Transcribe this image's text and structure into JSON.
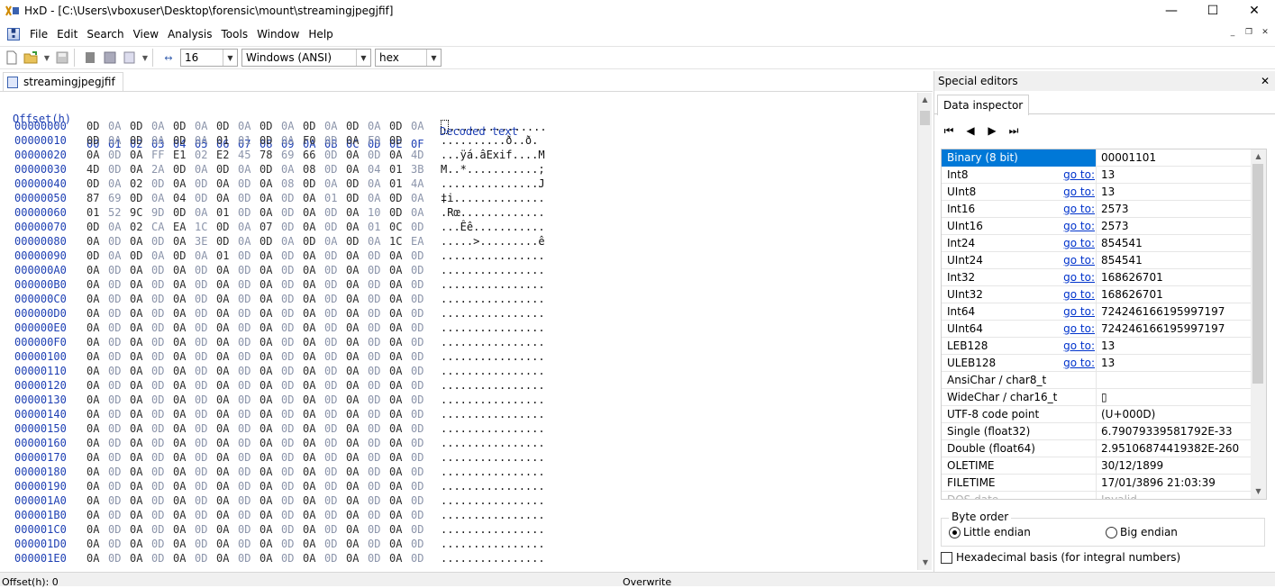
{
  "window": {
    "title": "HxD - [C:\\Users\\vboxuser\\Desktop\\forensic\\mount\\streamingjpegjfif]",
    "minimize": "—",
    "maximize": "☐",
    "close": "✕"
  },
  "menu": {
    "items": [
      "File",
      "Edit",
      "Search",
      "View",
      "Analysis",
      "Tools",
      "Window",
      "Help"
    ],
    "mdi_minimize": "_",
    "mdi_restore": "❐",
    "mdi_close": "✕"
  },
  "toolbar": {
    "bytes_per_row": "16",
    "charset": "Windows (ANSI)",
    "offset_base": "hex"
  },
  "document_tab": {
    "label": "streamingjpegjfif"
  },
  "hex_view": {
    "offset_header": "Offset(h)",
    "column_headers": [
      "00",
      "01",
      "02",
      "03",
      "04",
      "05",
      "06",
      "07",
      "08",
      "09",
      "0A",
      "0B",
      "0C",
      "0D",
      "0E",
      "0F"
    ],
    "decoded_header": "Decoded text",
    "rows": [
      {
        "offset": "00000000",
        "bytes": [
          "0D",
          "0A",
          "0D",
          "0A",
          "0D",
          "0A",
          "0D",
          "0A",
          "0D",
          "0A",
          "0D",
          "0A",
          "0D",
          "0A",
          "0D",
          "0A"
        ],
        "decoded_first": ".",
        "decoded": "..............."
      },
      {
        "offset": "00000010",
        "bytes": [
          "0D",
          "0A",
          "0D",
          "0A",
          "0D",
          "0A",
          "01",
          "01",
          "0D",
          "0A",
          "F0",
          "0D",
          "0A",
          "F0",
          "0D",
          ""
        ],
        "decoded": "..........ð..ð."
      },
      {
        "offset": "00000020",
        "bytes": [
          "0A",
          "0D",
          "0A",
          "FF",
          "E1",
          "02",
          "E2",
          "45",
          "78",
          "69",
          "66",
          "0D",
          "0A",
          "0D",
          "0A",
          "4D"
        ],
        "decoded": "...ÿá.âExif....M"
      },
      {
        "offset": "00000030",
        "bytes": [
          "4D",
          "0D",
          "0A",
          "2A",
          "0D",
          "0A",
          "0D",
          "0A",
          "0D",
          "0A",
          "08",
          "0D",
          "0A",
          "04",
          "01",
          "3B"
        ],
        "decoded": "M..*...........;"
      },
      {
        "offset": "00000040",
        "bytes": [
          "0D",
          "0A",
          "02",
          "0D",
          "0A",
          "0D",
          "0A",
          "0D",
          "0A",
          "08",
          "0D",
          "0A",
          "0D",
          "0A",
          "01",
          "4A"
        ],
        "decoded": "...............J"
      },
      {
        "offset": "00000050",
        "bytes": [
          "87",
          "69",
          "0D",
          "0A",
          "04",
          "0D",
          "0A",
          "0D",
          "0A",
          "0D",
          "0A",
          "01",
          "0D",
          "0A",
          "0D",
          "0A"
        ],
        "decoded": "‡i.............."
      },
      {
        "offset": "00000060",
        "bytes": [
          "01",
          "52",
          "9C",
          "9D",
          "0D",
          "0A",
          "01",
          "0D",
          "0A",
          "0D",
          "0A",
          "0D",
          "0A",
          "10",
          "0D",
          "0A"
        ],
        "decoded": ".Rœ............."
      },
      {
        "offset": "00000070",
        "bytes": [
          "0D",
          "0A",
          "02",
          "CA",
          "EA",
          "1C",
          "0D",
          "0A",
          "07",
          "0D",
          "0A",
          "0D",
          "0A",
          "01",
          "0C",
          "0D"
        ],
        "decoded": "...Êê..........."
      },
      {
        "offset": "00000080",
        "bytes": [
          "0A",
          "0D",
          "0A",
          "0D",
          "0A",
          "3E",
          "0D",
          "0A",
          "0D",
          "0A",
          "0D",
          "0A",
          "0D",
          "0A",
          "1C",
          "EA"
        ],
        "decoded": ".....>.........ê"
      },
      {
        "offset": "00000090",
        "bytes": [
          "0D",
          "0A",
          "0D",
          "0A",
          "0D",
          "0A",
          "01",
          "0D",
          "0A",
          "0D",
          "0A",
          "0D",
          "0A",
          "0D",
          "0A",
          "0D"
        ],
        "decoded": "................"
      },
      {
        "offset": "000000A0",
        "bytes": [
          "0A",
          "0D",
          "0A",
          "0D",
          "0A",
          "0D",
          "0A",
          "0D",
          "0A",
          "0D",
          "0A",
          "0D",
          "0A",
          "0D",
          "0A",
          "0D"
        ],
        "decoded": "................"
      },
      {
        "offset": "000000B0",
        "bytes": [
          "0A",
          "0D",
          "0A",
          "0D",
          "0A",
          "0D",
          "0A",
          "0D",
          "0A",
          "0D",
          "0A",
          "0D",
          "0A",
          "0D",
          "0A",
          "0D"
        ],
        "decoded": "................"
      },
      {
        "offset": "000000C0",
        "bytes": [
          "0A",
          "0D",
          "0A",
          "0D",
          "0A",
          "0D",
          "0A",
          "0D",
          "0A",
          "0D",
          "0A",
          "0D",
          "0A",
          "0D",
          "0A",
          "0D"
        ],
        "decoded": "................"
      },
      {
        "offset": "000000D0",
        "bytes": [
          "0A",
          "0D",
          "0A",
          "0D",
          "0A",
          "0D",
          "0A",
          "0D",
          "0A",
          "0D",
          "0A",
          "0D",
          "0A",
          "0D",
          "0A",
          "0D"
        ],
        "decoded": "................"
      },
      {
        "offset": "000000E0",
        "bytes": [
          "0A",
          "0D",
          "0A",
          "0D",
          "0A",
          "0D",
          "0A",
          "0D",
          "0A",
          "0D",
          "0A",
          "0D",
          "0A",
          "0D",
          "0A",
          "0D"
        ],
        "decoded": "................"
      },
      {
        "offset": "000000F0",
        "bytes": [
          "0A",
          "0D",
          "0A",
          "0D",
          "0A",
          "0D",
          "0A",
          "0D",
          "0A",
          "0D",
          "0A",
          "0D",
          "0A",
          "0D",
          "0A",
          "0D"
        ],
        "decoded": "................"
      },
      {
        "offset": "00000100",
        "bytes": [
          "0A",
          "0D",
          "0A",
          "0D",
          "0A",
          "0D",
          "0A",
          "0D",
          "0A",
          "0D",
          "0A",
          "0D",
          "0A",
          "0D",
          "0A",
          "0D"
        ],
        "decoded": "................"
      },
      {
        "offset": "00000110",
        "bytes": [
          "0A",
          "0D",
          "0A",
          "0D",
          "0A",
          "0D",
          "0A",
          "0D",
          "0A",
          "0D",
          "0A",
          "0D",
          "0A",
          "0D",
          "0A",
          "0D"
        ],
        "decoded": "................"
      },
      {
        "offset": "00000120",
        "bytes": [
          "0A",
          "0D",
          "0A",
          "0D",
          "0A",
          "0D",
          "0A",
          "0D",
          "0A",
          "0D",
          "0A",
          "0D",
          "0A",
          "0D",
          "0A",
          "0D"
        ],
        "decoded": "................"
      },
      {
        "offset": "00000130",
        "bytes": [
          "0A",
          "0D",
          "0A",
          "0D",
          "0A",
          "0D",
          "0A",
          "0D",
          "0A",
          "0D",
          "0A",
          "0D",
          "0A",
          "0D",
          "0A",
          "0D"
        ],
        "decoded": "................"
      },
      {
        "offset": "00000140",
        "bytes": [
          "0A",
          "0D",
          "0A",
          "0D",
          "0A",
          "0D",
          "0A",
          "0D",
          "0A",
          "0D",
          "0A",
          "0D",
          "0A",
          "0D",
          "0A",
          "0D"
        ],
        "decoded": "................"
      },
      {
        "offset": "00000150",
        "bytes": [
          "0A",
          "0D",
          "0A",
          "0D",
          "0A",
          "0D",
          "0A",
          "0D",
          "0A",
          "0D",
          "0A",
          "0D",
          "0A",
          "0D",
          "0A",
          "0D"
        ],
        "decoded": "................"
      },
      {
        "offset": "00000160",
        "bytes": [
          "0A",
          "0D",
          "0A",
          "0D",
          "0A",
          "0D",
          "0A",
          "0D",
          "0A",
          "0D",
          "0A",
          "0D",
          "0A",
          "0D",
          "0A",
          "0D"
        ],
        "decoded": "................"
      },
      {
        "offset": "00000170",
        "bytes": [
          "0A",
          "0D",
          "0A",
          "0D",
          "0A",
          "0D",
          "0A",
          "0D",
          "0A",
          "0D",
          "0A",
          "0D",
          "0A",
          "0D",
          "0A",
          "0D"
        ],
        "decoded": "................"
      },
      {
        "offset": "00000180",
        "bytes": [
          "0A",
          "0D",
          "0A",
          "0D",
          "0A",
          "0D",
          "0A",
          "0D",
          "0A",
          "0D",
          "0A",
          "0D",
          "0A",
          "0D",
          "0A",
          "0D"
        ],
        "decoded": "................"
      },
      {
        "offset": "00000190",
        "bytes": [
          "0A",
          "0D",
          "0A",
          "0D",
          "0A",
          "0D",
          "0A",
          "0D",
          "0A",
          "0D",
          "0A",
          "0D",
          "0A",
          "0D",
          "0A",
          "0D"
        ],
        "decoded": "................"
      },
      {
        "offset": "000001A0",
        "bytes": [
          "0A",
          "0D",
          "0A",
          "0D",
          "0A",
          "0D",
          "0A",
          "0D",
          "0A",
          "0D",
          "0A",
          "0D",
          "0A",
          "0D",
          "0A",
          "0D"
        ],
        "decoded": "................"
      },
      {
        "offset": "000001B0",
        "bytes": [
          "0A",
          "0D",
          "0A",
          "0D",
          "0A",
          "0D",
          "0A",
          "0D",
          "0A",
          "0D",
          "0A",
          "0D",
          "0A",
          "0D",
          "0A",
          "0D"
        ],
        "decoded": "................"
      },
      {
        "offset": "000001C0",
        "bytes": [
          "0A",
          "0D",
          "0A",
          "0D",
          "0A",
          "0D",
          "0A",
          "0D",
          "0A",
          "0D",
          "0A",
          "0D",
          "0A",
          "0D",
          "0A",
          "0D"
        ],
        "decoded": "................"
      },
      {
        "offset": "000001D0",
        "bytes": [
          "0A",
          "0D",
          "0A",
          "0D",
          "0A",
          "0D",
          "0A",
          "0D",
          "0A",
          "0D",
          "0A",
          "0D",
          "0A",
          "0D",
          "0A",
          "0D"
        ],
        "decoded": "................"
      },
      {
        "offset": "000001E0",
        "bytes": [
          "0A",
          "0D",
          "0A",
          "0D",
          "0A",
          "0D",
          "0A",
          "0D",
          "0A",
          "0D",
          "0A",
          "0D",
          "0A",
          "0D",
          "0A",
          "0D"
        ],
        "decoded": "................"
      }
    ]
  },
  "special_editors": {
    "title": "Special editors",
    "close": "✕",
    "tab": "Data inspector",
    "nav": [
      "⏮",
      "◀",
      "▶",
      "⏭"
    ],
    "goto_label": "go to:",
    "fields": [
      {
        "name": "Binary (8 bit)",
        "value": "00001101",
        "goto": false,
        "selected": true
      },
      {
        "name": "Int8",
        "value": "13",
        "goto": true
      },
      {
        "name": "UInt8",
        "value": "13",
        "goto": true
      },
      {
        "name": "Int16",
        "value": "2573",
        "goto": true
      },
      {
        "name": "UInt16",
        "value": "2573",
        "goto": true
      },
      {
        "name": "Int24",
        "value": "854541",
        "goto": true
      },
      {
        "name": "UInt24",
        "value": "854541",
        "goto": true
      },
      {
        "name": "Int32",
        "value": "168626701",
        "goto": true
      },
      {
        "name": "UInt32",
        "value": "168626701",
        "goto": true
      },
      {
        "name": "Int64",
        "value": "724246166195997197",
        "goto": true
      },
      {
        "name": "UInt64",
        "value": "724246166195997197",
        "goto": true
      },
      {
        "name": "LEB128",
        "value": "13",
        "goto": true
      },
      {
        "name": "ULEB128",
        "value": "13",
        "goto": true
      },
      {
        "name": "AnsiChar / char8_t",
        "value": "",
        "goto": false
      },
      {
        "name": "WideChar / char16_t",
        "value": "▯",
        "goto": false
      },
      {
        "name": "UTF-8 code point",
        "value": " (U+000D)",
        "goto": false
      },
      {
        "name": "Single (float32)",
        "value": "6.79079339581792E-33",
        "goto": false
      },
      {
        "name": "Double (float64)",
        "value": "2.95106874419382E-260",
        "goto": false
      },
      {
        "name": "OLETIME",
        "value": "30/12/1899",
        "goto": false
      },
      {
        "name": "FILETIME",
        "value": "17/01/3896 21:03:39",
        "goto": false
      },
      {
        "name": "DOS date",
        "value": "Invalid",
        "goto": false,
        "faded": true
      }
    ],
    "byte_order_label": "Byte order",
    "little_endian": "Little endian",
    "big_endian": "Big endian",
    "hex_basis_label": "Hexadecimal basis (for integral numbers)"
  },
  "status": {
    "offset": "Offset(h): 0",
    "mode": "Overwrite"
  },
  "colors": {
    "offset_blue": "#1d3fb3",
    "odd_byte_gray": "#8b94aa",
    "selection_blue": "#0078d7",
    "link_blue": "#0033cc"
  }
}
